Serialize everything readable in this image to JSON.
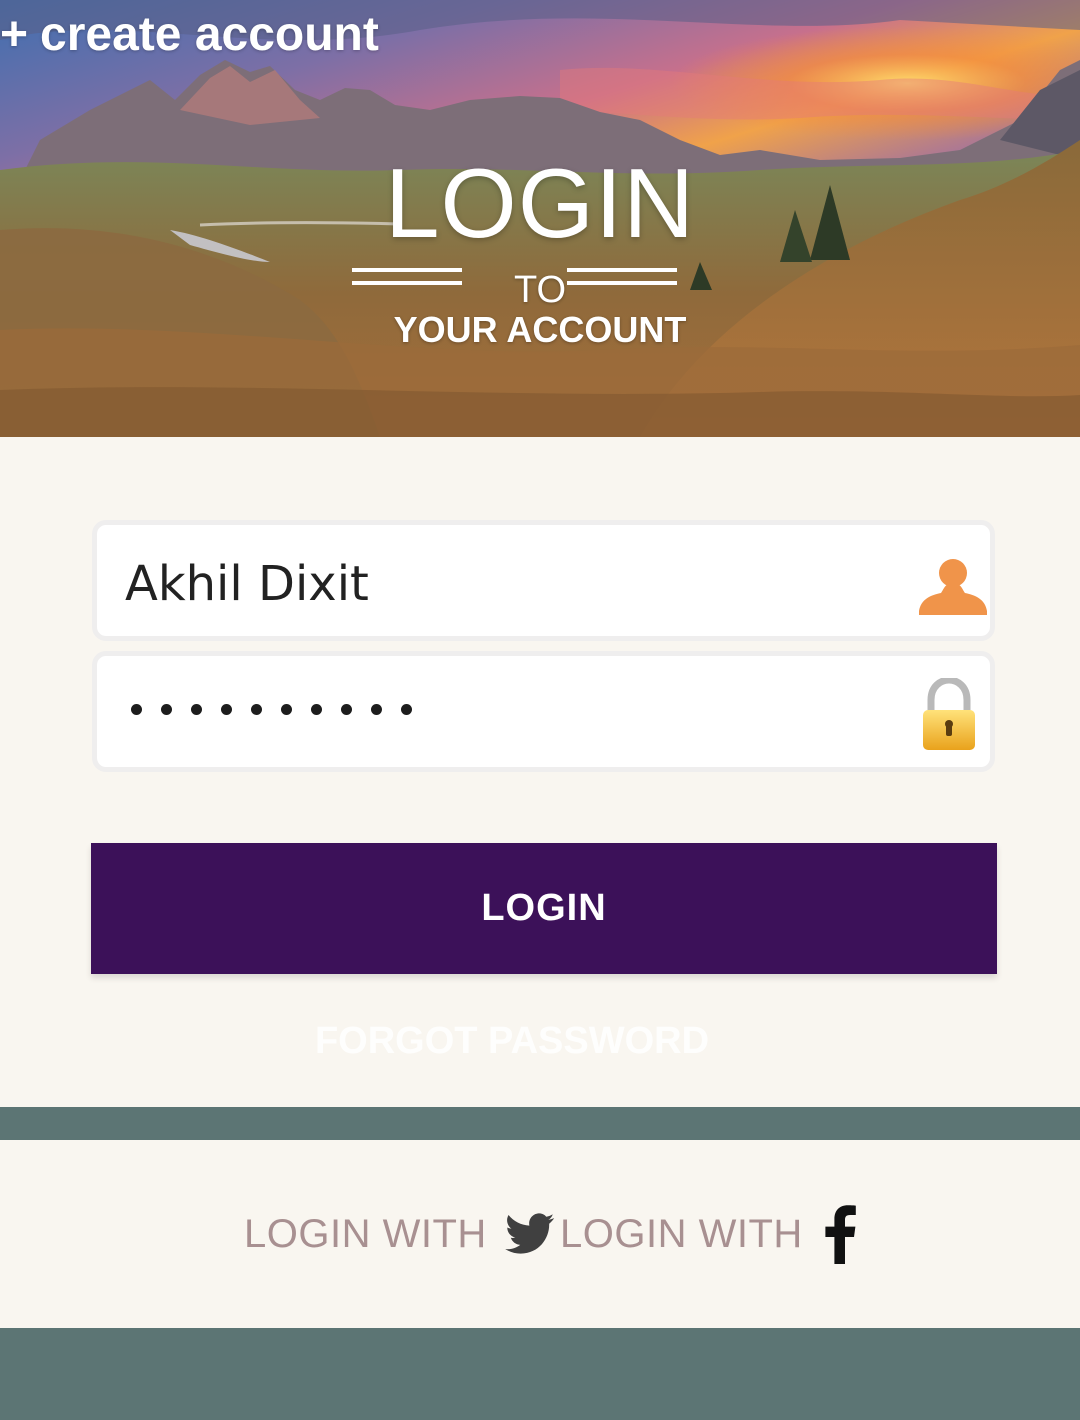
{
  "header": {
    "create_account_label": "create account"
  },
  "hero": {
    "title": "LOGIN",
    "to": "TO",
    "subtitle": "YOUR ACCOUNT"
  },
  "form": {
    "username_value": "Akhil Dixit",
    "password_masked": "••••••••••",
    "password_length": 10,
    "login_label": "LOGIN",
    "forgot_label": "FORGOT PASSWORD"
  },
  "social": {
    "twitter_label": "LOGIN WITH",
    "twitter_icon": "twitter-bird-icon",
    "facebook_label": "LOGIN WITH",
    "facebook_icon": "facebook-f-icon"
  },
  "colors": {
    "primary_button": "#3c1159",
    "band": "#5c7574",
    "background": "#f9f6f0",
    "social_text": "#a89091",
    "user_icon": "#f0944a"
  }
}
